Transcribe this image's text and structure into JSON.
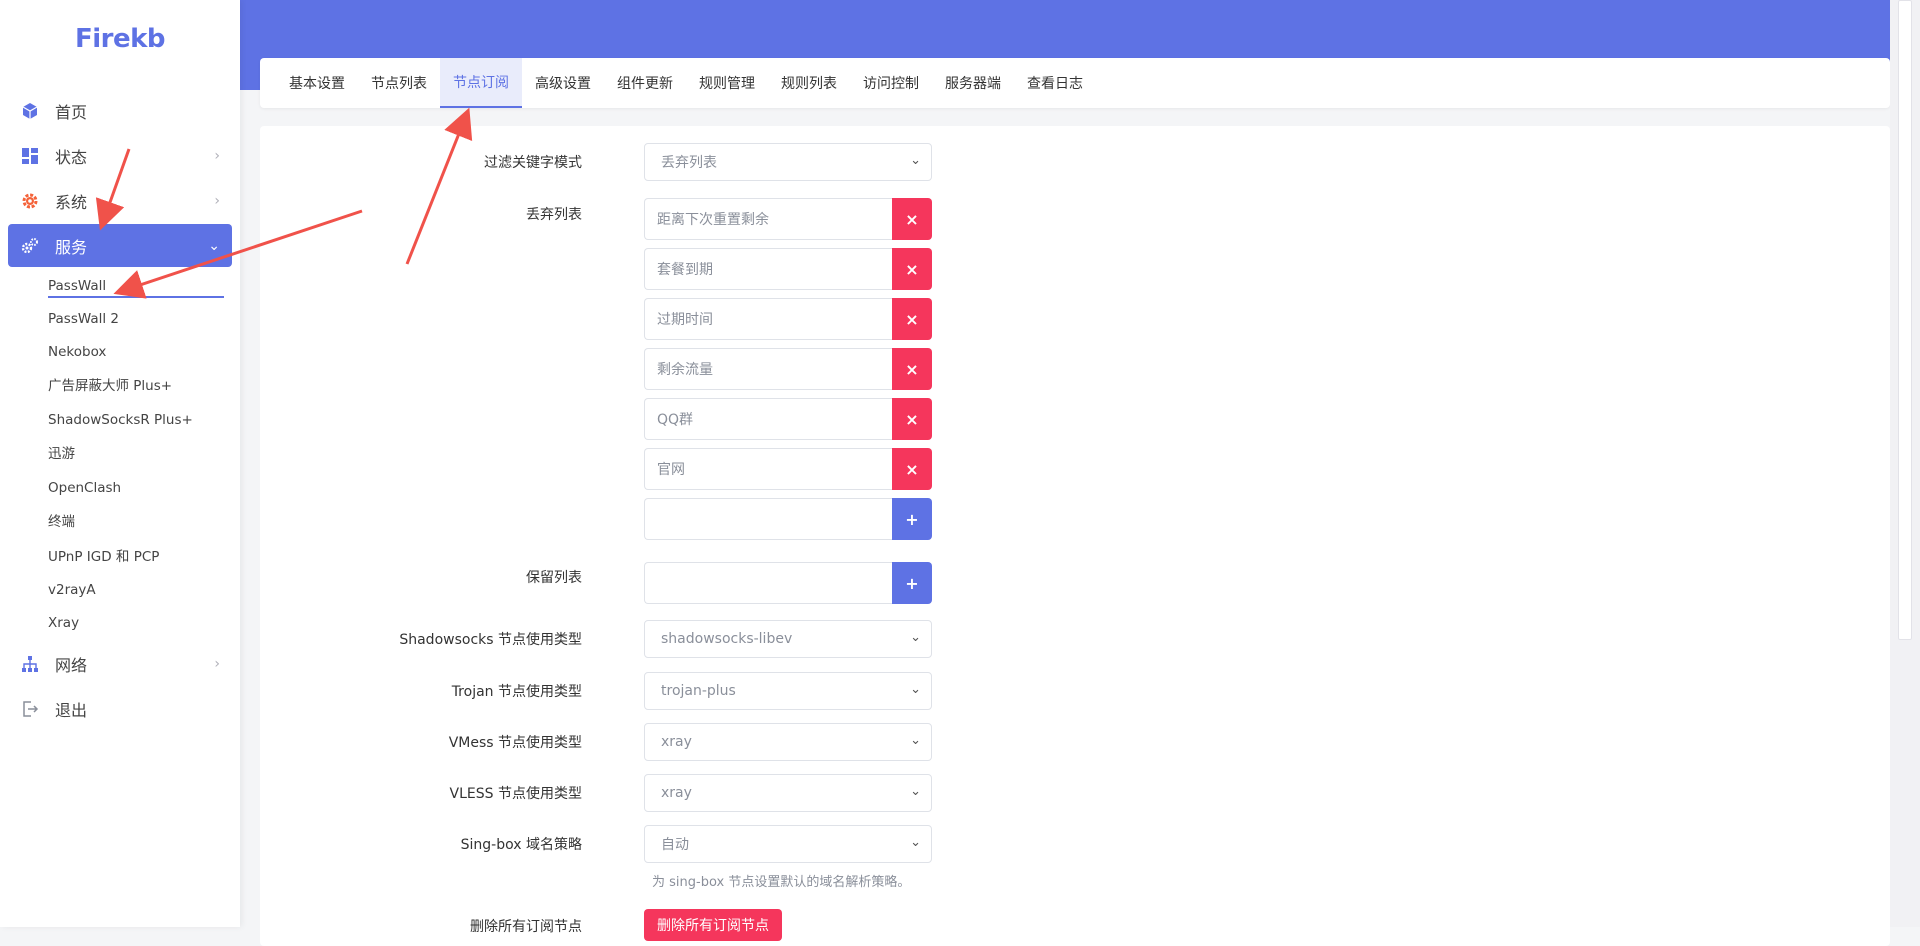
{
  "app": {
    "logo": "Firekb"
  },
  "sidebar": {
    "items": [
      {
        "label": "首页",
        "icon": "cube-icon"
      },
      {
        "label": "状态",
        "icon": "dashboard-icon"
      },
      {
        "label": "系统",
        "icon": "gear-icon"
      },
      {
        "label": "服务",
        "icon": "gears-icon"
      },
      {
        "label": "网络",
        "icon": "sitemap-icon"
      },
      {
        "label": "退出",
        "icon": "logout-icon"
      }
    ],
    "services": [
      "PassWall",
      "PassWall 2",
      "Nekobox",
      "广告屏蔽大师 Plus+",
      "ShadowSocksR Plus+",
      "迅游",
      "OpenClash",
      "终端",
      "UPnP IGD 和 PCP",
      "v2rayA",
      "Xray"
    ]
  },
  "tabs": [
    "基本设置",
    "节点列表",
    "节点订阅",
    "高级设置",
    "组件更新",
    "规则管理",
    "规则列表",
    "访问控制",
    "服务器端",
    "查看日志"
  ],
  "active_tab": "节点订阅",
  "form": {
    "filter_mode": {
      "label": "过滤关键字模式",
      "value": "丢弃列表"
    },
    "discard_list": {
      "label": "丢弃列表",
      "items": [
        "距离下次重置剩余",
        "套餐到期",
        "过期时间",
        "剩余流量",
        "QQ群",
        "官网"
      ],
      "remove_symbol": "×",
      "add_symbol": "+"
    },
    "keep_list": {
      "label": "保留列表",
      "add_symbol": "+"
    },
    "ss_type": {
      "label": "Shadowsocks 节点使用类型",
      "value": "shadowsocks-libev"
    },
    "trojan_type": {
      "label": "Trojan 节点使用类型",
      "value": "trojan-plus"
    },
    "vmess_type": {
      "label": "VMess 节点使用类型",
      "value": "xray"
    },
    "vless_type": {
      "label": "VLESS 节点使用类型",
      "value": "xray"
    },
    "singbox_domain": {
      "label": "Sing-box 域名策略",
      "value": "自动",
      "hint": "为 sing-box 节点设置默认的域名解析策略。"
    },
    "delete_all": {
      "label": "删除所有订阅节点",
      "button": "删除所有订阅节点"
    }
  },
  "colors": {
    "accent": "#5e72e4",
    "danger": "#f5365c",
    "annotation": "#f0524a"
  }
}
